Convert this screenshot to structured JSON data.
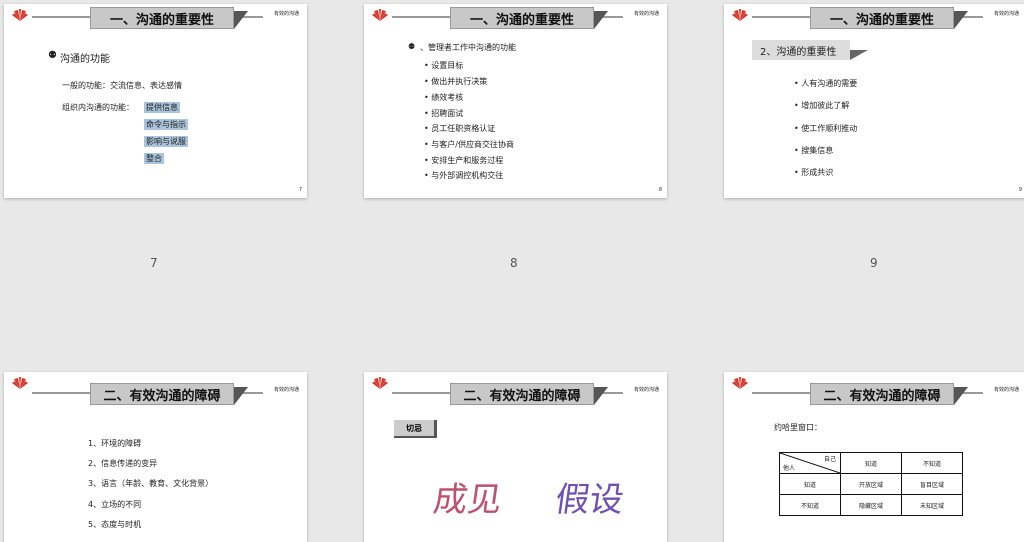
{
  "slides": {
    "s7": {
      "title": "一、沟通的重要性",
      "tag": "有效的沟通",
      "page": "7",
      "heading": "沟通的功能",
      "general": "一般的功能：交流信息、表达感情",
      "org_label": "组织内沟通的功能：",
      "org_items": [
        "提供信息",
        "命令与指示",
        "影响与说服",
        "整合"
      ]
    },
    "s8": {
      "title": "一、沟通的重要性",
      "tag": "有效的沟通",
      "page": "8",
      "heading": "、管理者工作中沟通的功能",
      "items": [
        "设置目标",
        "做出并执行决策",
        "绩效考核",
        "招聘面试",
        "员工任职资格认证",
        "与客户/供应商交往协商",
        "安排生产和服务过程",
        "与外部调控机构交往"
      ]
    },
    "s9": {
      "title": "一、沟通的重要性",
      "tag": "有效的沟通",
      "page": "9",
      "section": "2、沟通的重要性",
      "items": [
        "人有沟通的需要",
        "增加彼此了解",
        "使工作顺利推动",
        "搜集信息",
        "形成共识"
      ]
    },
    "s10": {
      "title": "二、有效沟通的障碍",
      "tag": "有效的沟通",
      "items": [
        "1、环境的障碍",
        "2、信息传递的变异",
        "3、语言（年龄、教育、文化背景）",
        "4、立场的不同",
        "5、态度与时机"
      ]
    },
    "s11": {
      "title": "二、有效沟通的障碍",
      "tag": "有效的沟通",
      "label": "切忌",
      "word1": "成见",
      "word2": "假设"
    },
    "s12": {
      "title": "二、有效沟通的障碍",
      "tag": "有效的沟通",
      "intro": "约哈里窗口：",
      "corner_top": "自己",
      "corner_bottom": "他人",
      "col1": "知道",
      "col2": "不知道",
      "row1": "知道",
      "row2": "不知道",
      "c11": "开放区域",
      "c12": "盲目区域",
      "c21": "隐藏区域",
      "c22": "未知区域"
    }
  },
  "captions": [
    "7",
    "8",
    "9"
  ],
  "colors": {
    "highlight": "#aac4dc",
    "title_bg": "#c8c8c8",
    "logo": "#d9362b"
  },
  "icons": {
    "logo": "huawei-logo-icon",
    "bullet": "bullet-icon"
  }
}
